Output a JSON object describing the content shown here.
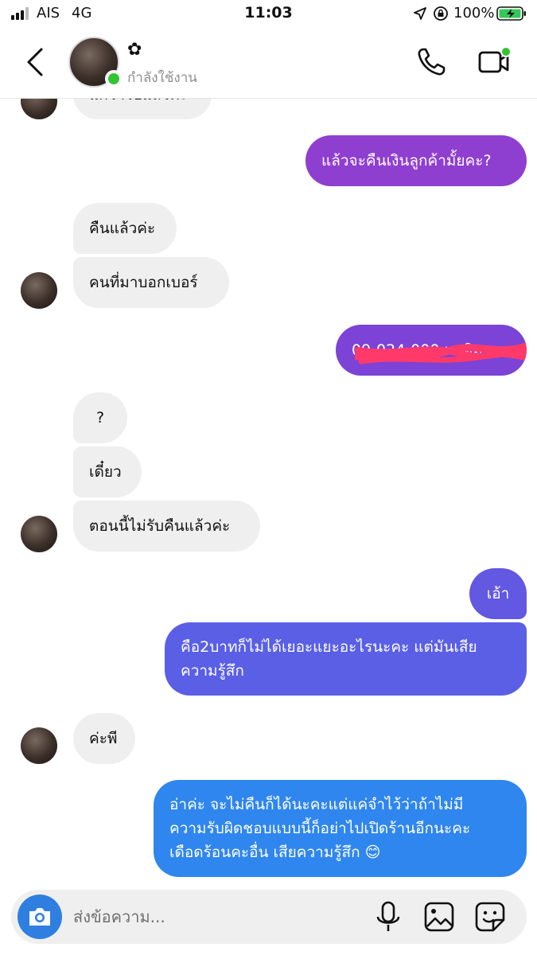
{
  "status_bar": {
    "carrier": "AIS",
    "network": "4G",
    "time": "11:03",
    "battery": "100%"
  },
  "header": {
    "contact_name": "✿",
    "contact_status": "กำลังใช้งาน"
  },
  "messages": {
    "m0": "แก้ว่าไปแล้วค่ะ",
    "m1": "แล้วจะคืนเงินลูกค้ามั้ยคะ?",
    "m2": "คืนแล้วค่ะ",
    "m3": "คนที่มาบอกเบอร์",
    "m4": "09-024-000 เอเอิม",
    "m5": "?",
    "m6": "เดี๋ยว",
    "m7": "ตอนนี้ไม่รับคืนแล้วค่ะ",
    "m8": "เอ้า",
    "m9_line1": "คือ2บาทก็ไม่ได้เยอะแยะอะไรนะคะ แต่มันเสีย",
    "m9_line2": "ความรู้สึก",
    "m10": "ค่ะพี",
    "m11_line1": "อ่าค่ะ จะไม่คืนก็ได้นะคะแต่แค่จำไว้ว่าถ้าไม่มี",
    "m11_line2": "ความรับผิดชอบแบบนี้ก็อย่าไปเปิดร้านอีกนะคะ",
    "m11_line3": "เดือดร้อนคะอื่น เสียความรู้สึก 😊"
  },
  "composer": {
    "placeholder": "ส่งข้อความ..."
  },
  "colors": {
    "online": "#31c631",
    "camera_button": "#2f7fe0",
    "bubble_purple": "#8f3fd0",
    "bubble_indigo": "#5a5fe6",
    "bubble_blue": "#2f86ee"
  }
}
